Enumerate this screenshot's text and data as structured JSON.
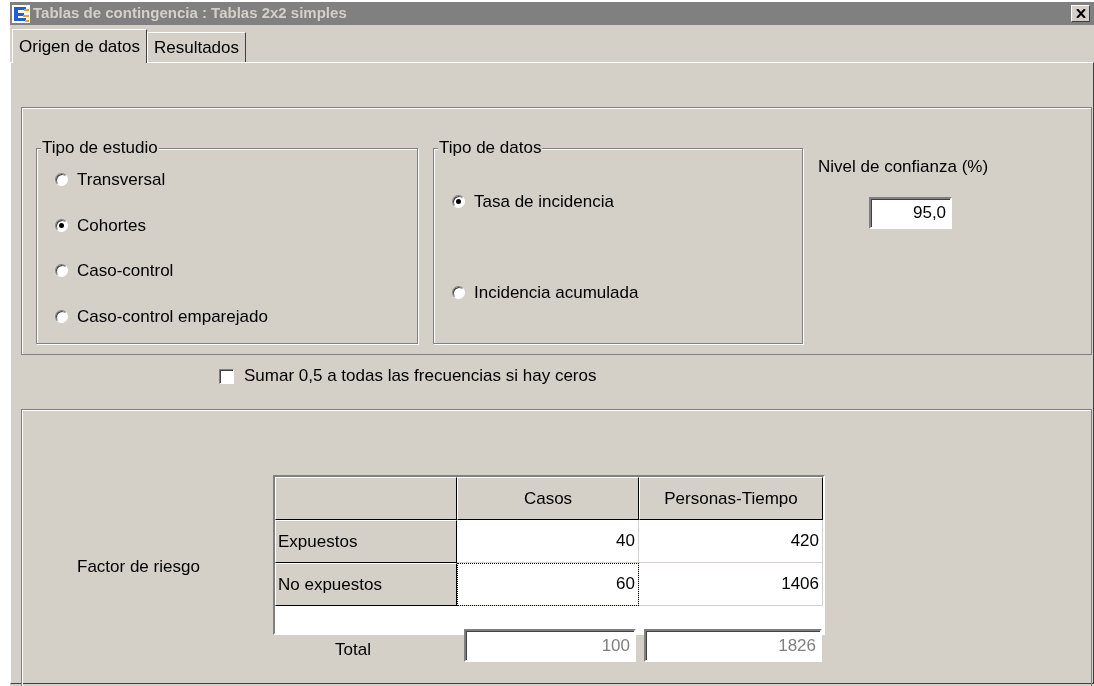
{
  "window": {
    "title": "Tablas de contingencia : Tablas 2x2 simples"
  },
  "tabs": [
    {
      "label": "Origen de datos",
      "selected": true
    },
    {
      "label": "Resultados",
      "selected": false
    }
  ],
  "study_type": {
    "legend": "Tipo de estudio",
    "options": [
      {
        "label": "Transversal",
        "selected": false
      },
      {
        "label": "Cohortes",
        "selected": true
      },
      {
        "label": "Caso-control",
        "selected": false
      },
      {
        "label": "Caso-control emparejado",
        "selected": false
      }
    ]
  },
  "data_type": {
    "legend": "Tipo de datos",
    "options": [
      {
        "label": "Tasa de incidencia",
        "selected": true
      },
      {
        "label": "Incidencia acumulada",
        "selected": false
      }
    ]
  },
  "confidence": {
    "label": "Nivel de confianza (%)",
    "value": "95,0"
  },
  "zero_correction": {
    "label": "Sumar 0,5 a todas las frecuencias si hay ceros",
    "checked": false
  },
  "table": {
    "side_label": "Factor de riesgo",
    "columns": [
      "Casos",
      "Personas-Tiempo"
    ],
    "rows": [
      {
        "label": "Expuestos",
        "cells": [
          {
            "value": "40",
            "focused": false
          },
          {
            "value": "420",
            "focused": false
          }
        ]
      },
      {
        "label": "No expuestos",
        "cells": [
          {
            "value": "60",
            "focused": true
          },
          {
            "value": "1406",
            "focused": false
          }
        ]
      }
    ]
  },
  "totals": {
    "label": "Total",
    "values": [
      "100",
      "1826"
    ]
  }
}
